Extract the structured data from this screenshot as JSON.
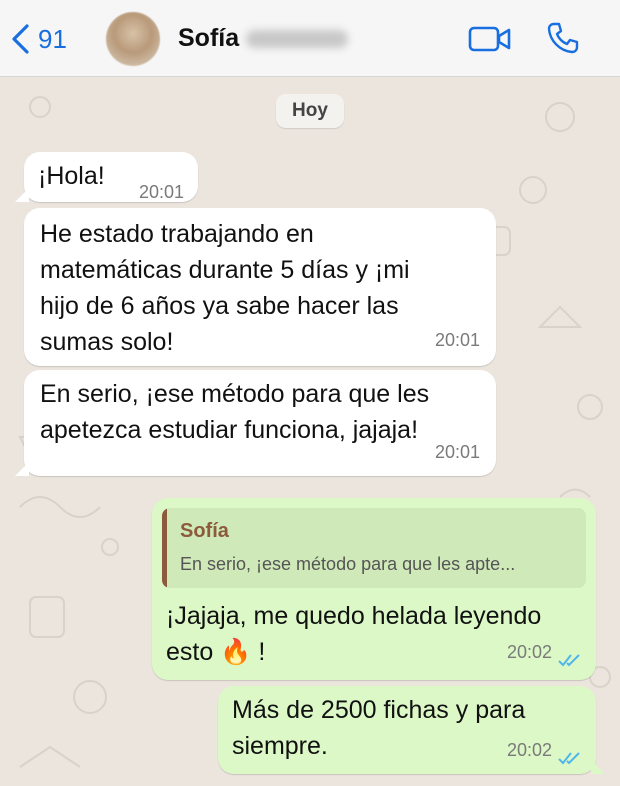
{
  "header": {
    "back_count": "91",
    "contact_name": "Sofía",
    "icons": {
      "back": "chevron-left-icon",
      "video": "video-camera-icon",
      "call": "phone-icon"
    },
    "accent_color": "#1a6fe0"
  },
  "chat": {
    "date_label": "Hoy",
    "messages": [
      {
        "direction": "in",
        "text": "¡Hola!",
        "time": "20:01"
      },
      {
        "direction": "in",
        "text": "He estado trabajando en\nmatemáticas durante 5 días y ¡mi\nhijo de 6 años ya sabe hacer las\nsumas solo!",
        "time": "20:01"
      },
      {
        "direction": "in",
        "text": "En serio, ¡ese método para que les\napetezca estudiar funciona, jajaja!",
        "time": "20:01"
      },
      {
        "direction": "out",
        "quote": {
          "name": "Sofía",
          "text": "En serio, ¡ese método para que les apte..."
        },
        "text": "¡Jajaja, me quedo helada leyendo\nesto",
        "emoji": "🔥",
        "text_end": "!",
        "time": "20:02",
        "status": "read"
      },
      {
        "direction": "out",
        "text": "Más de 2500 fichas y para\nsiempre.",
        "time": "20:02",
        "status": "read"
      }
    ],
    "colors": {
      "incoming": "#ffffff",
      "outgoing": "#dcf8c6",
      "read_ticks": "#4fb6ec",
      "background": "#ebe5de"
    }
  }
}
